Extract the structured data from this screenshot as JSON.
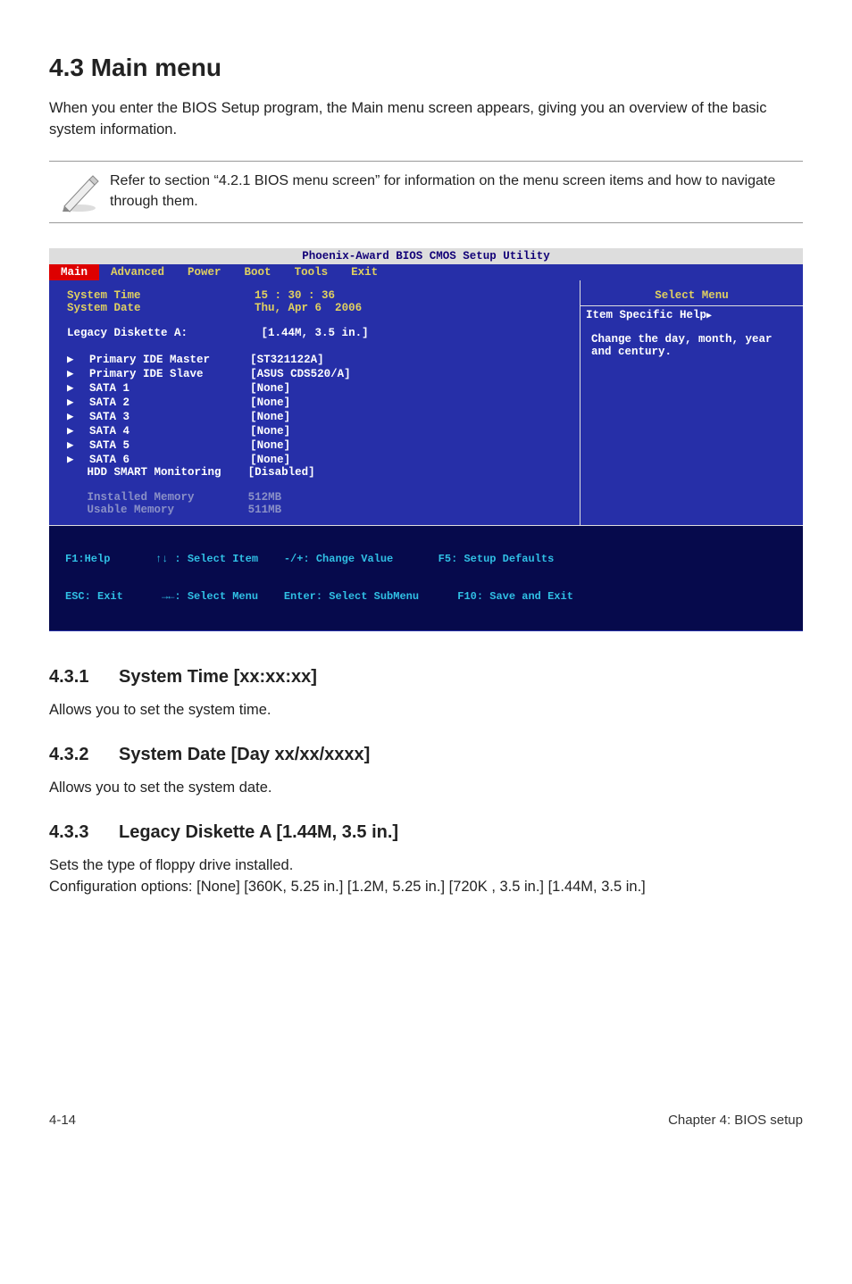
{
  "section": {
    "title": "4.3     Main menu",
    "intro": "When you enter the BIOS Setup program, the Main menu screen appears, giving you an overview of the basic system information."
  },
  "note": {
    "text": "Refer to section “4.2.1 BIOS menu screen” for information on the menu screen items and how to navigate through them."
  },
  "bios": {
    "title": "Phoenix-Award BIOS CMOS Setup Utility",
    "menu": [
      "Main",
      "Advanced",
      "Power",
      "Boot",
      "Tools",
      "Exit"
    ],
    "system_time_label": "System Time",
    "system_time_value": "15 : 30 : 36",
    "system_date_label": "System Date",
    "system_date_value": "Thu, Apr 6  2006",
    "legacy_label": "Legacy Diskette A:",
    "legacy_value": "[1.44M, 3.5 in.]",
    "rows": [
      {
        "label": "Primary IDE Master",
        "value": "[ST321122A]"
      },
      {
        "label": "Primary IDE Slave",
        "value": "[ASUS CDS520/A]"
      },
      {
        "label": "SATA 1",
        "value": "[None]"
      },
      {
        "label": "SATA 2",
        "value": "[None]"
      },
      {
        "label": "SATA 3",
        "value": "[None]"
      },
      {
        "label": "SATA 4",
        "value": "[None]"
      },
      {
        "label": "SATA 5",
        "value": "[None]"
      },
      {
        "label": "SATA 6",
        "value": "[None]"
      },
      {
        "label": "HDD SMART Monitoring",
        "value": "[Disabled]"
      }
    ],
    "grey_rows": [
      {
        "label": "Installed Memory",
        "value": "512MB"
      },
      {
        "label": "Usable Memory",
        "value": "511MB"
      }
    ],
    "help_title": "Select Menu",
    "help_line": "Item Specific Help",
    "help_text": "Change the day, month, year and century.",
    "footer1_keys": "F1:Help       ↑↓ : Select Item    -/+: Change Value       F5: Setup Defaults",
    "footer2_keys": "ESC: Exit      →←: Select Menu    Enter: Select SubMenu      F10: Save and Exit"
  },
  "sub1": {
    "num": "4.3.1",
    "title": "System Time [xx:xx:xx]",
    "text": "Allows you to set the system time."
  },
  "sub2": {
    "num": "4.3.2",
    "title": "System Date [Day xx/xx/xxxx]",
    "text": "Allows you to set the system date."
  },
  "sub3": {
    "num": "4.3.3",
    "title": "Legacy Diskette A [1.44M, 3.5 in.]",
    "text1": "Sets the type of floppy drive installed.",
    "text2": "Configuration options: [None] [360K, 5.25 in.]  [1.2M, 5.25 in.] [720K , 3.5 in.] [1.44M, 3.5 in.]"
  },
  "footer": {
    "left": "4-14",
    "right": "Chapter 4: BIOS setup"
  }
}
